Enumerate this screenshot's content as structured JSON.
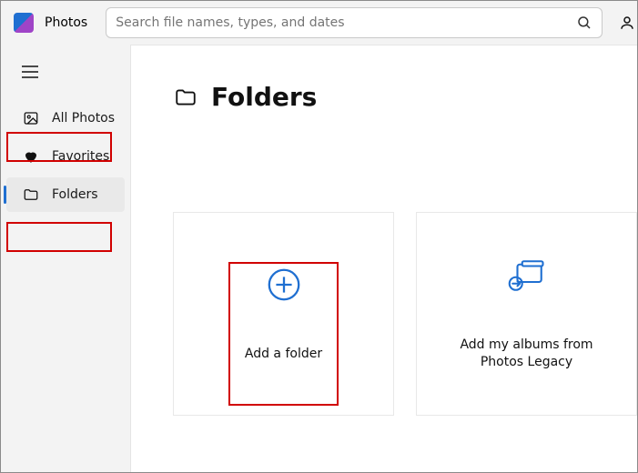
{
  "app": {
    "title": "Photos"
  },
  "search": {
    "placeholder": "Search file names, types, and dates",
    "value": ""
  },
  "sidebar": {
    "items": [
      {
        "label": "All Photos",
        "icon": "image-icon"
      },
      {
        "label": "Favorites",
        "icon": "heart-icon"
      },
      {
        "label": "Folders",
        "icon": "folder-icon",
        "selected": true
      }
    ]
  },
  "page": {
    "heading": "Folders"
  },
  "tiles": {
    "add_folder": {
      "label": "Add a folder"
    },
    "legacy": {
      "label_line1": "Add my albums from",
      "label_line2": "Photos Legacy"
    }
  },
  "annotations": {
    "highlight_nav": [
      "All Photos",
      "Folders"
    ],
    "highlight_tile": "Add a folder"
  },
  "colors": {
    "accent": "#1f6fd1",
    "annotation": "#d10000"
  }
}
